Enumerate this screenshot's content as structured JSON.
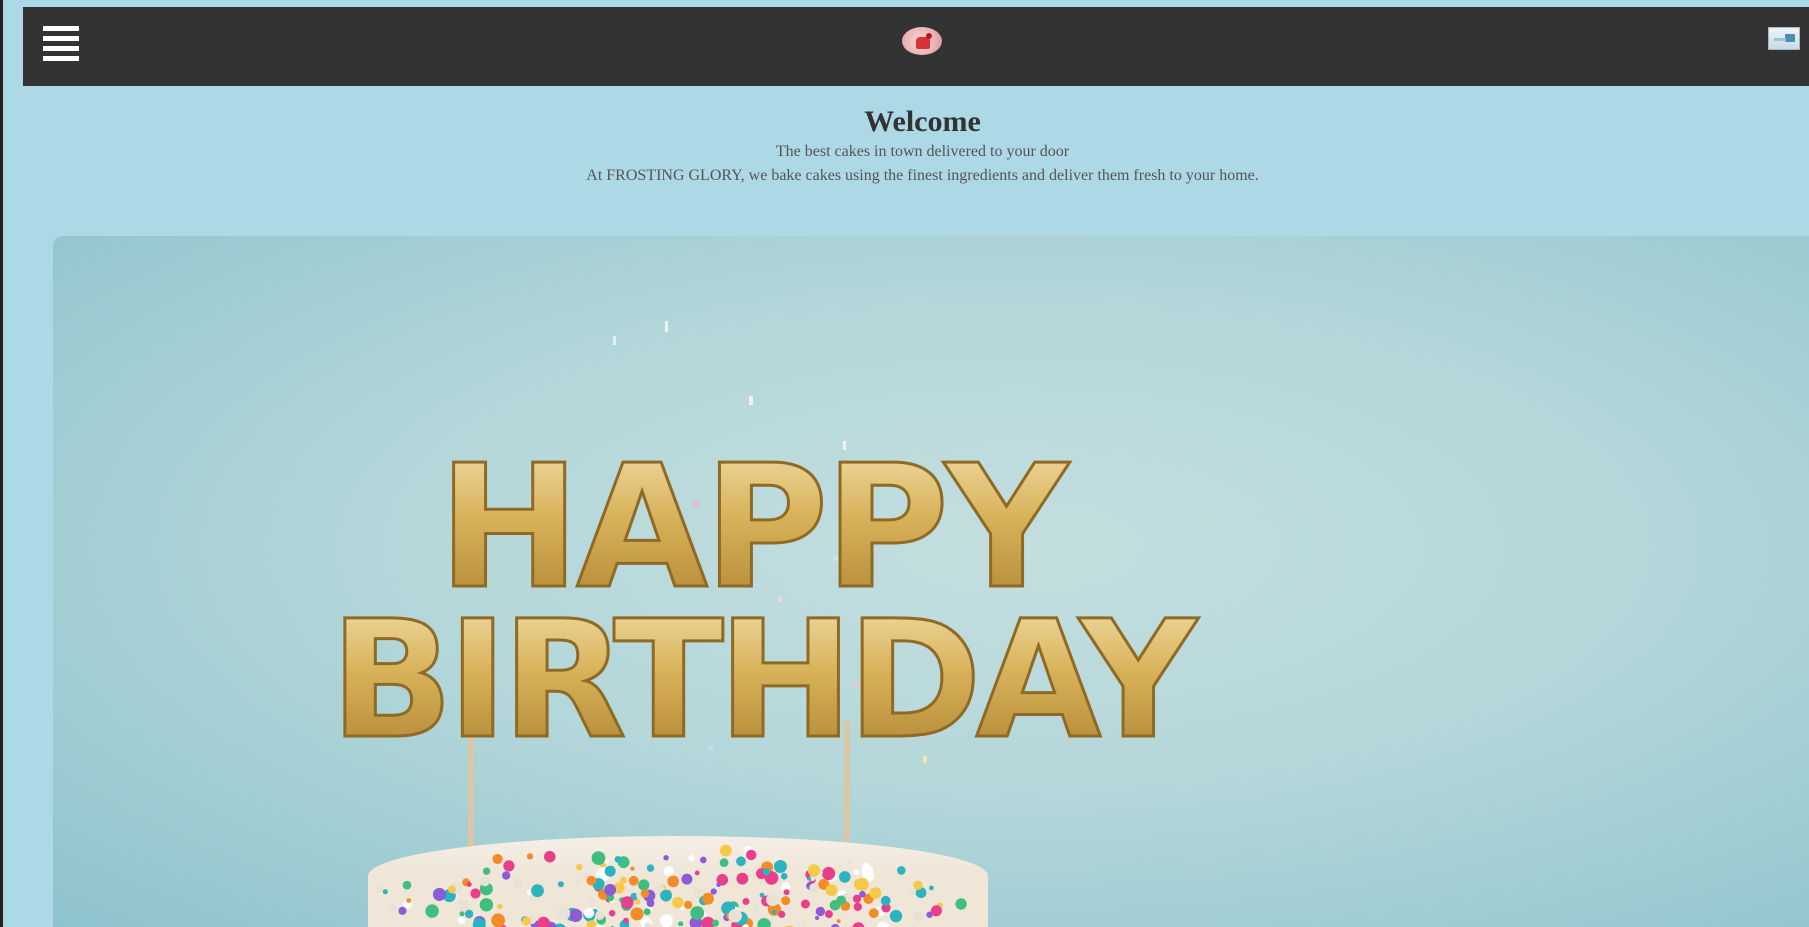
{
  "header": {
    "menu_icon": "hamburger-menu-icon",
    "logo_icon": "cake-logo-icon",
    "cart_icon": "cart-image-icon"
  },
  "welcome": {
    "title": "Welcome",
    "tagline": "The best cakes in town delivered to your door",
    "description": "At FROSTING GLORY, we bake cakes using the finest ingredients and deliver them fresh to your home."
  },
  "hero": {
    "line1": "HAPPY",
    "line2": "BIRTHDAY"
  },
  "colors": {
    "page_background": "#add8e6",
    "header_background": "#333333",
    "title_text": "#333333",
    "body_text": "#555555",
    "balloon_gold": "#d8b25a"
  }
}
